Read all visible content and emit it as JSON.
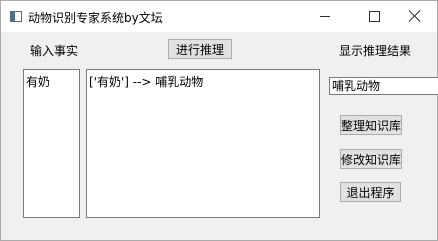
{
  "window": {
    "title": "动物识别专家系统by文坛",
    "controls": {
      "minimize_icon": "minimize-icon",
      "maximize_icon": "maximize-icon",
      "close_icon": "close-icon"
    }
  },
  "labels": {
    "input_facts": "输入事实",
    "show_result": "显示推理结果"
  },
  "buttons": {
    "infer": "进行推理",
    "organize_kb": "整理知识库",
    "modify_kb": "修改知识库",
    "exit": "退出程序"
  },
  "facts_input": {
    "value": "有奶"
  },
  "reasoning_output": {
    "value": "['有奶'] --> 哺乳动物"
  },
  "result_field": {
    "value": "哺乳动物"
  },
  "colors": {
    "window_bg": "#f0f0f0",
    "titlebar_bg": "#ffffff",
    "button_bg": "#e1e1e1",
    "button_border": "#adadad"
  }
}
